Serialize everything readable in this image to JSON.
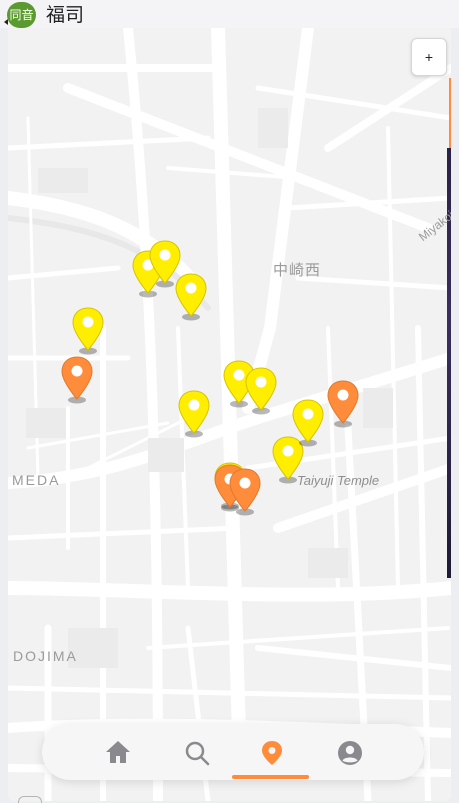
{
  "header": {
    "badge_text": "同音",
    "title": "福司",
    "badge_color": "#5a9a2f"
  },
  "map": {
    "zoom_button_label": "+",
    "labels": {
      "meda": "MEDA",
      "dojima": "DOJIMA",
      "nakazaki": "中崎西",
      "taiyuji": "Taiyuji Temple",
      "miyako": "Miyakoj"
    },
    "pin_colors": {
      "yellow": "#ffee00",
      "orange": "#ff8c3b"
    },
    "pins": [
      {
        "color": "yellow"
      },
      {
        "color": "yellow"
      },
      {
        "color": "yellow"
      },
      {
        "color": "yellow"
      },
      {
        "color": "orange"
      },
      {
        "color": "yellow"
      },
      {
        "color": "yellow"
      },
      {
        "color": "yellow"
      },
      {
        "color": "orange"
      },
      {
        "color": "yellow"
      },
      {
        "color": "yellow"
      },
      {
        "color": "yellow"
      },
      {
        "color": "orange"
      },
      {
        "color": "orange"
      }
    ]
  },
  "nav": {
    "items": [
      {
        "icon": "home-icon"
      },
      {
        "icon": "search-icon"
      },
      {
        "icon": "map-pin-icon"
      },
      {
        "icon": "user-icon"
      }
    ],
    "active_index": 2,
    "active_color": "#ff8c3b",
    "inactive_color": "#8a8a8e"
  }
}
